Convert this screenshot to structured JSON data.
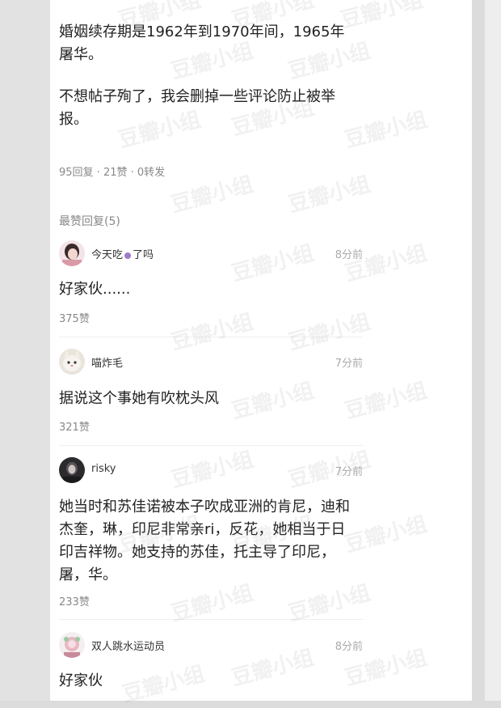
{
  "post": {
    "paragraph1": "婚姻续存期是1962年到1970年间，1965年屠华。",
    "paragraph2": "不想帖子殉了，我会删掉一些评论防止被举报。",
    "stats": "95回复 · 21赞 · 0转发"
  },
  "replies_section": {
    "title": "最赞回复(5)"
  },
  "comments": [
    {
      "username_part1": "今天吃",
      "username_part2": "了吗",
      "time": "8分前",
      "text": "好家伙......",
      "likes": "375赞"
    },
    {
      "username": "喵炸毛",
      "time": "7分前",
      "text": "据说这个事她有吹枕头风",
      "likes": "321赞"
    },
    {
      "username": "risky",
      "time": "7分前",
      "text": "她当时和苏佳诺被本子吹成亚洲的肯尼，迪和杰奎，琳，印尼非常亲ri，反花，她相当于日印吉祥物。她支持的苏佳，托主导了印尼，屠，华。",
      "likes": "233赞"
    },
    {
      "username": "双人跳水运动员",
      "time": "8分前",
      "text": "好家伙"
    }
  ],
  "watermark_text": "豆瓣小组",
  "icons": {
    "avatar1": "avatar-girl-icon",
    "avatar2": "avatar-cat-icon",
    "avatar3": "avatar-dark-icon",
    "avatar4": "avatar-pink-icon",
    "emoji": "emoji-icon"
  },
  "colors": {
    "text": "#222222",
    "muted": "#888888",
    "time": "#aaaaaa"
  }
}
